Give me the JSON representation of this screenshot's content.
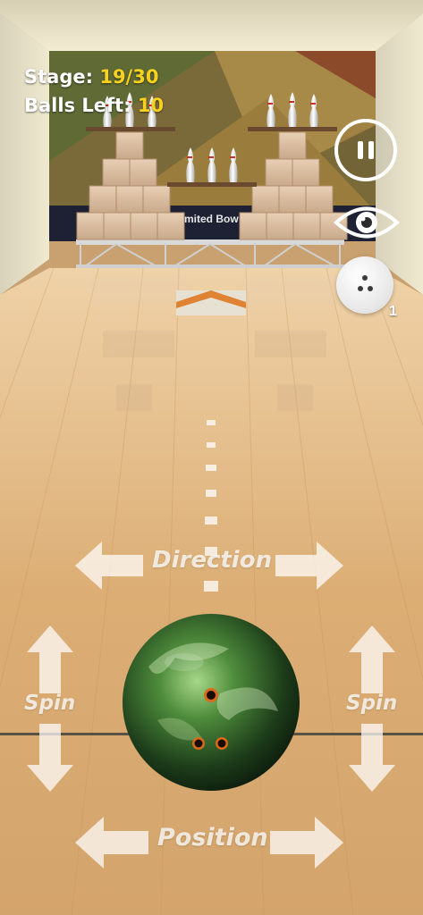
{
  "hud": {
    "stage_label": "Stage: ",
    "stage_value": "19/30",
    "balls_label": "Balls Left: ",
    "balls_value": "10"
  },
  "buttons": {
    "pause_icon": "pause-icon",
    "view_icon": "eye-icon",
    "ball_icon": "bowling-ball-icon",
    "ball_count": "1"
  },
  "lane_sign": "mited Bow",
  "controls": {
    "direction_label": "Direction",
    "position_label": "Position",
    "spin_left_label": "Spin",
    "spin_right_label": "Spin"
  },
  "colors": {
    "hud_value": "#f6d21f",
    "hud_text": "#ffffff",
    "lane": "#d9ad78",
    "ball_primary": "#2f6a2a"
  }
}
